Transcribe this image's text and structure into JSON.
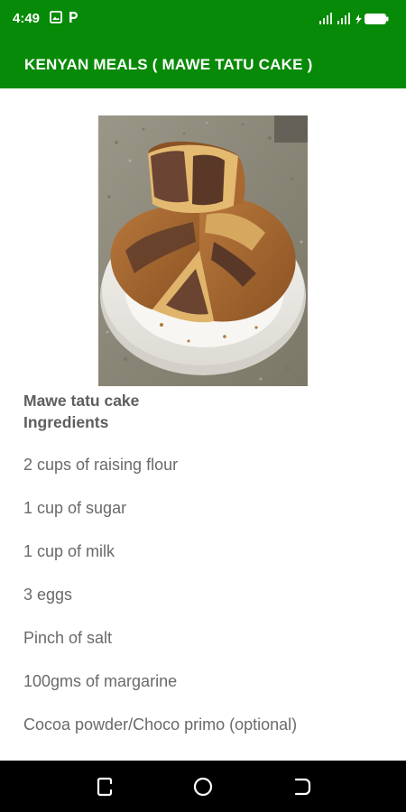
{
  "status_bar": {
    "time": "4:49",
    "icons_left": [
      "image-icon",
      "p-icon"
    ],
    "icons_right": [
      "signal-icon",
      "signal-icon",
      "battery-charging-icon"
    ]
  },
  "app_bar": {
    "title": "KENYAN MEALS ( MAWE TATU CAKE )",
    "background": "#078a07"
  },
  "recipe": {
    "image": "marble-cake-photo",
    "name": "Mawe tatu cake",
    "ingredients_heading": "Ingredients",
    "ingredients": [
      "2 cups of raising flour",
      "1 cup of sugar",
      "1 cup of milk",
      "3 eggs",
      "Pinch of salt",
      "100gms of margarine",
      "Cocoa powder/Choco primo (optional)"
    ]
  },
  "nav_bar": {
    "buttons": [
      "recents-icon",
      "home-icon",
      "back-icon"
    ]
  }
}
